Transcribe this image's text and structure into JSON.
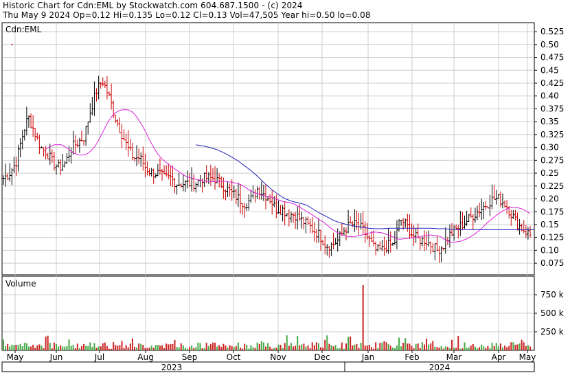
{
  "header": {
    "line1": "Historic Chart for Cdn:EML by Stockwatch.com 604.687.1500 - (c) 2024",
    "line2": "Thu May  9 2024  Op=0.12  Hi=0.135  Lo=0.12  Cl=0.13  Vol=47,505  Year hi=0.50  lo=0.08"
  },
  "colors": {
    "up": "#000000",
    "down": "#cc0000",
    "ma_short": "#dd22dd",
    "ma_long": "#2222bb",
    "vol_up": "#44aa44",
    "vol_down": "#cc2222",
    "grid": "#cccccc"
  },
  "chart_data": [
    {
      "type": "ohlc",
      "symbol_label": "Cdn:EML",
      "y_ticks": [
        "0.525",
        "0.50",
        "0.475",
        "0.45",
        "0.425",
        "0.40",
        "0.375",
        "0.35",
        "0.325",
        "0.30",
        "0.275",
        "0.25",
        "0.225",
        "0.20",
        "0.175",
        "0.15",
        "0.125",
        "0.10",
        "0.075"
      ],
      "ylim": [
        0.0525,
        0.5425
      ],
      "x_months": [
        "May",
        "Jun",
        "Jul",
        "Aug",
        "Sep",
        "Oct",
        "Nov",
        "Dec",
        "Jan",
        "Feb",
        "Mar",
        "Apr",
        "May"
      ],
      "x_years": [
        "2023",
        "2024"
      ],
      "grid": true,
      "series_close": [
        0.24,
        0.25,
        0.27,
        0.32,
        0.36,
        0.33,
        0.3,
        0.29,
        0.27,
        0.26,
        0.27,
        0.3,
        0.31,
        0.32,
        0.37,
        0.41,
        0.43,
        0.4,
        0.36,
        0.33,
        0.3,
        0.28,
        0.28,
        0.26,
        0.25,
        0.25,
        0.24,
        0.24,
        0.23,
        0.23,
        0.23,
        0.23,
        0.24,
        0.24,
        0.24,
        0.23,
        0.22,
        0.21,
        0.2,
        0.19,
        0.2,
        0.22,
        0.21,
        0.2,
        0.18,
        0.18,
        0.17,
        0.17,
        0.16,
        0.15,
        0.14,
        0.13,
        0.11,
        0.11,
        0.12,
        0.14,
        0.15,
        0.15,
        0.14,
        0.12,
        0.1,
        0.1,
        0.11,
        0.11,
        0.16,
        0.15,
        0.13,
        0.12,
        0.12,
        0.11,
        0.1,
        0.11,
        0.13,
        0.14,
        0.15,
        0.16,
        0.17,
        0.18,
        0.19,
        0.2,
        0.2,
        0.19,
        0.17,
        0.15,
        0.14,
        0.13
      ],
      "ma_short_start_index": 5,
      "ma_long": {
        "start_index": 36,
        "values": [
          0.305,
          0.303,
          0.3,
          0.296,
          0.29,
          0.283,
          0.275,
          0.265,
          0.255,
          0.243,
          0.23,
          0.218,
          0.208,
          0.2,
          0.195,
          0.192,
          0.188,
          0.18,
          0.172,
          0.165,
          0.158,
          0.153,
          0.15,
          0.147,
          0.145,
          0.143,
          0.142,
          0.142,
          0.143,
          0.143,
          0.143,
          0.143,
          0.143,
          0.143,
          0.143,
          0.142,
          0.142,
          0.141,
          0.14,
          0.14,
          0.14,
          0.14,
          0.14,
          0.14,
          0.14,
          0.14,
          0.14,
          0.14,
          0.14,
          0.14
        ]
      }
    },
    {
      "type": "bar",
      "title": "Volume",
      "y_ticks": [
        "750 k",
        "500 k",
        "250 k"
      ],
      "ylim": [
        0,
        1000
      ],
      "spike_index": 170,
      "spike_value": 880
    }
  ]
}
